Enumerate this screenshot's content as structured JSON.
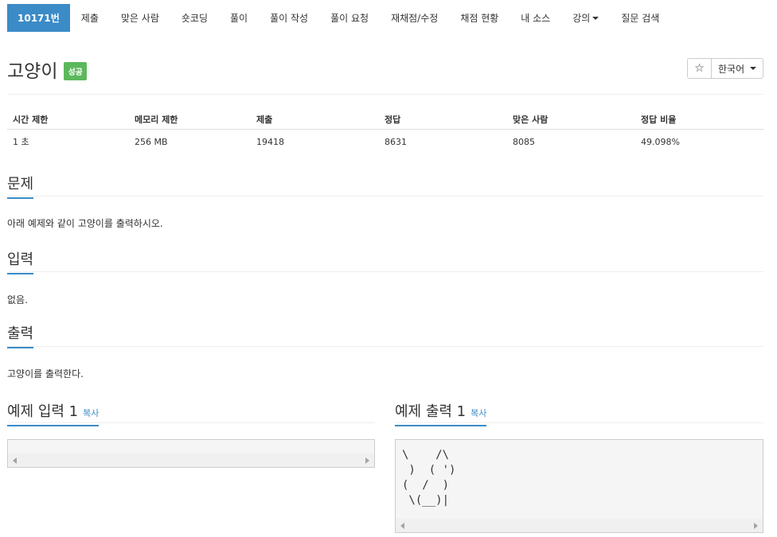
{
  "nav": {
    "tabs": [
      {
        "label": "10171번"
      },
      {
        "label": "제출"
      },
      {
        "label": "맞은 사람"
      },
      {
        "label": "숏코딩"
      },
      {
        "label": "풀이"
      },
      {
        "label": "풀이 작성"
      },
      {
        "label": "풀이 요청"
      },
      {
        "label": "재채점/수정"
      },
      {
        "label": "채점 현황"
      },
      {
        "label": "내 소스"
      },
      {
        "label": "강의"
      },
      {
        "label": "질문 검색"
      }
    ]
  },
  "problem": {
    "title": "고양이",
    "badge": "성공",
    "badge_color": "#5cb85c"
  },
  "controls": {
    "star_icon": "☆",
    "language": "한국어"
  },
  "info_table": {
    "headers": [
      "시간 제한",
      "메모리 제한",
      "제출",
      "정답",
      "맞은 사람",
      "정답 비율"
    ],
    "values": [
      "1 초",
      "256 MB",
      "19418",
      "8631",
      "8085",
      "49.098%"
    ]
  },
  "sections": {
    "problem_heading": "문제",
    "problem_text": "아래 예제와 같이 고양이를 출력하시오.",
    "input_heading": "입력",
    "input_text": "없음.",
    "output_heading": "출력",
    "output_text": "고양이를 출력한다."
  },
  "examples": {
    "input_heading": "예제 입력 1",
    "output_heading": "예제 출력 1",
    "copy_label": "복사",
    "input_content": "",
    "output_content": "\\    /\\\n )  ( ')\n(  /  )\n \\(__)|"
  },
  "colors": {
    "accent": "#3b8bc7",
    "success": "#5cb85c"
  }
}
